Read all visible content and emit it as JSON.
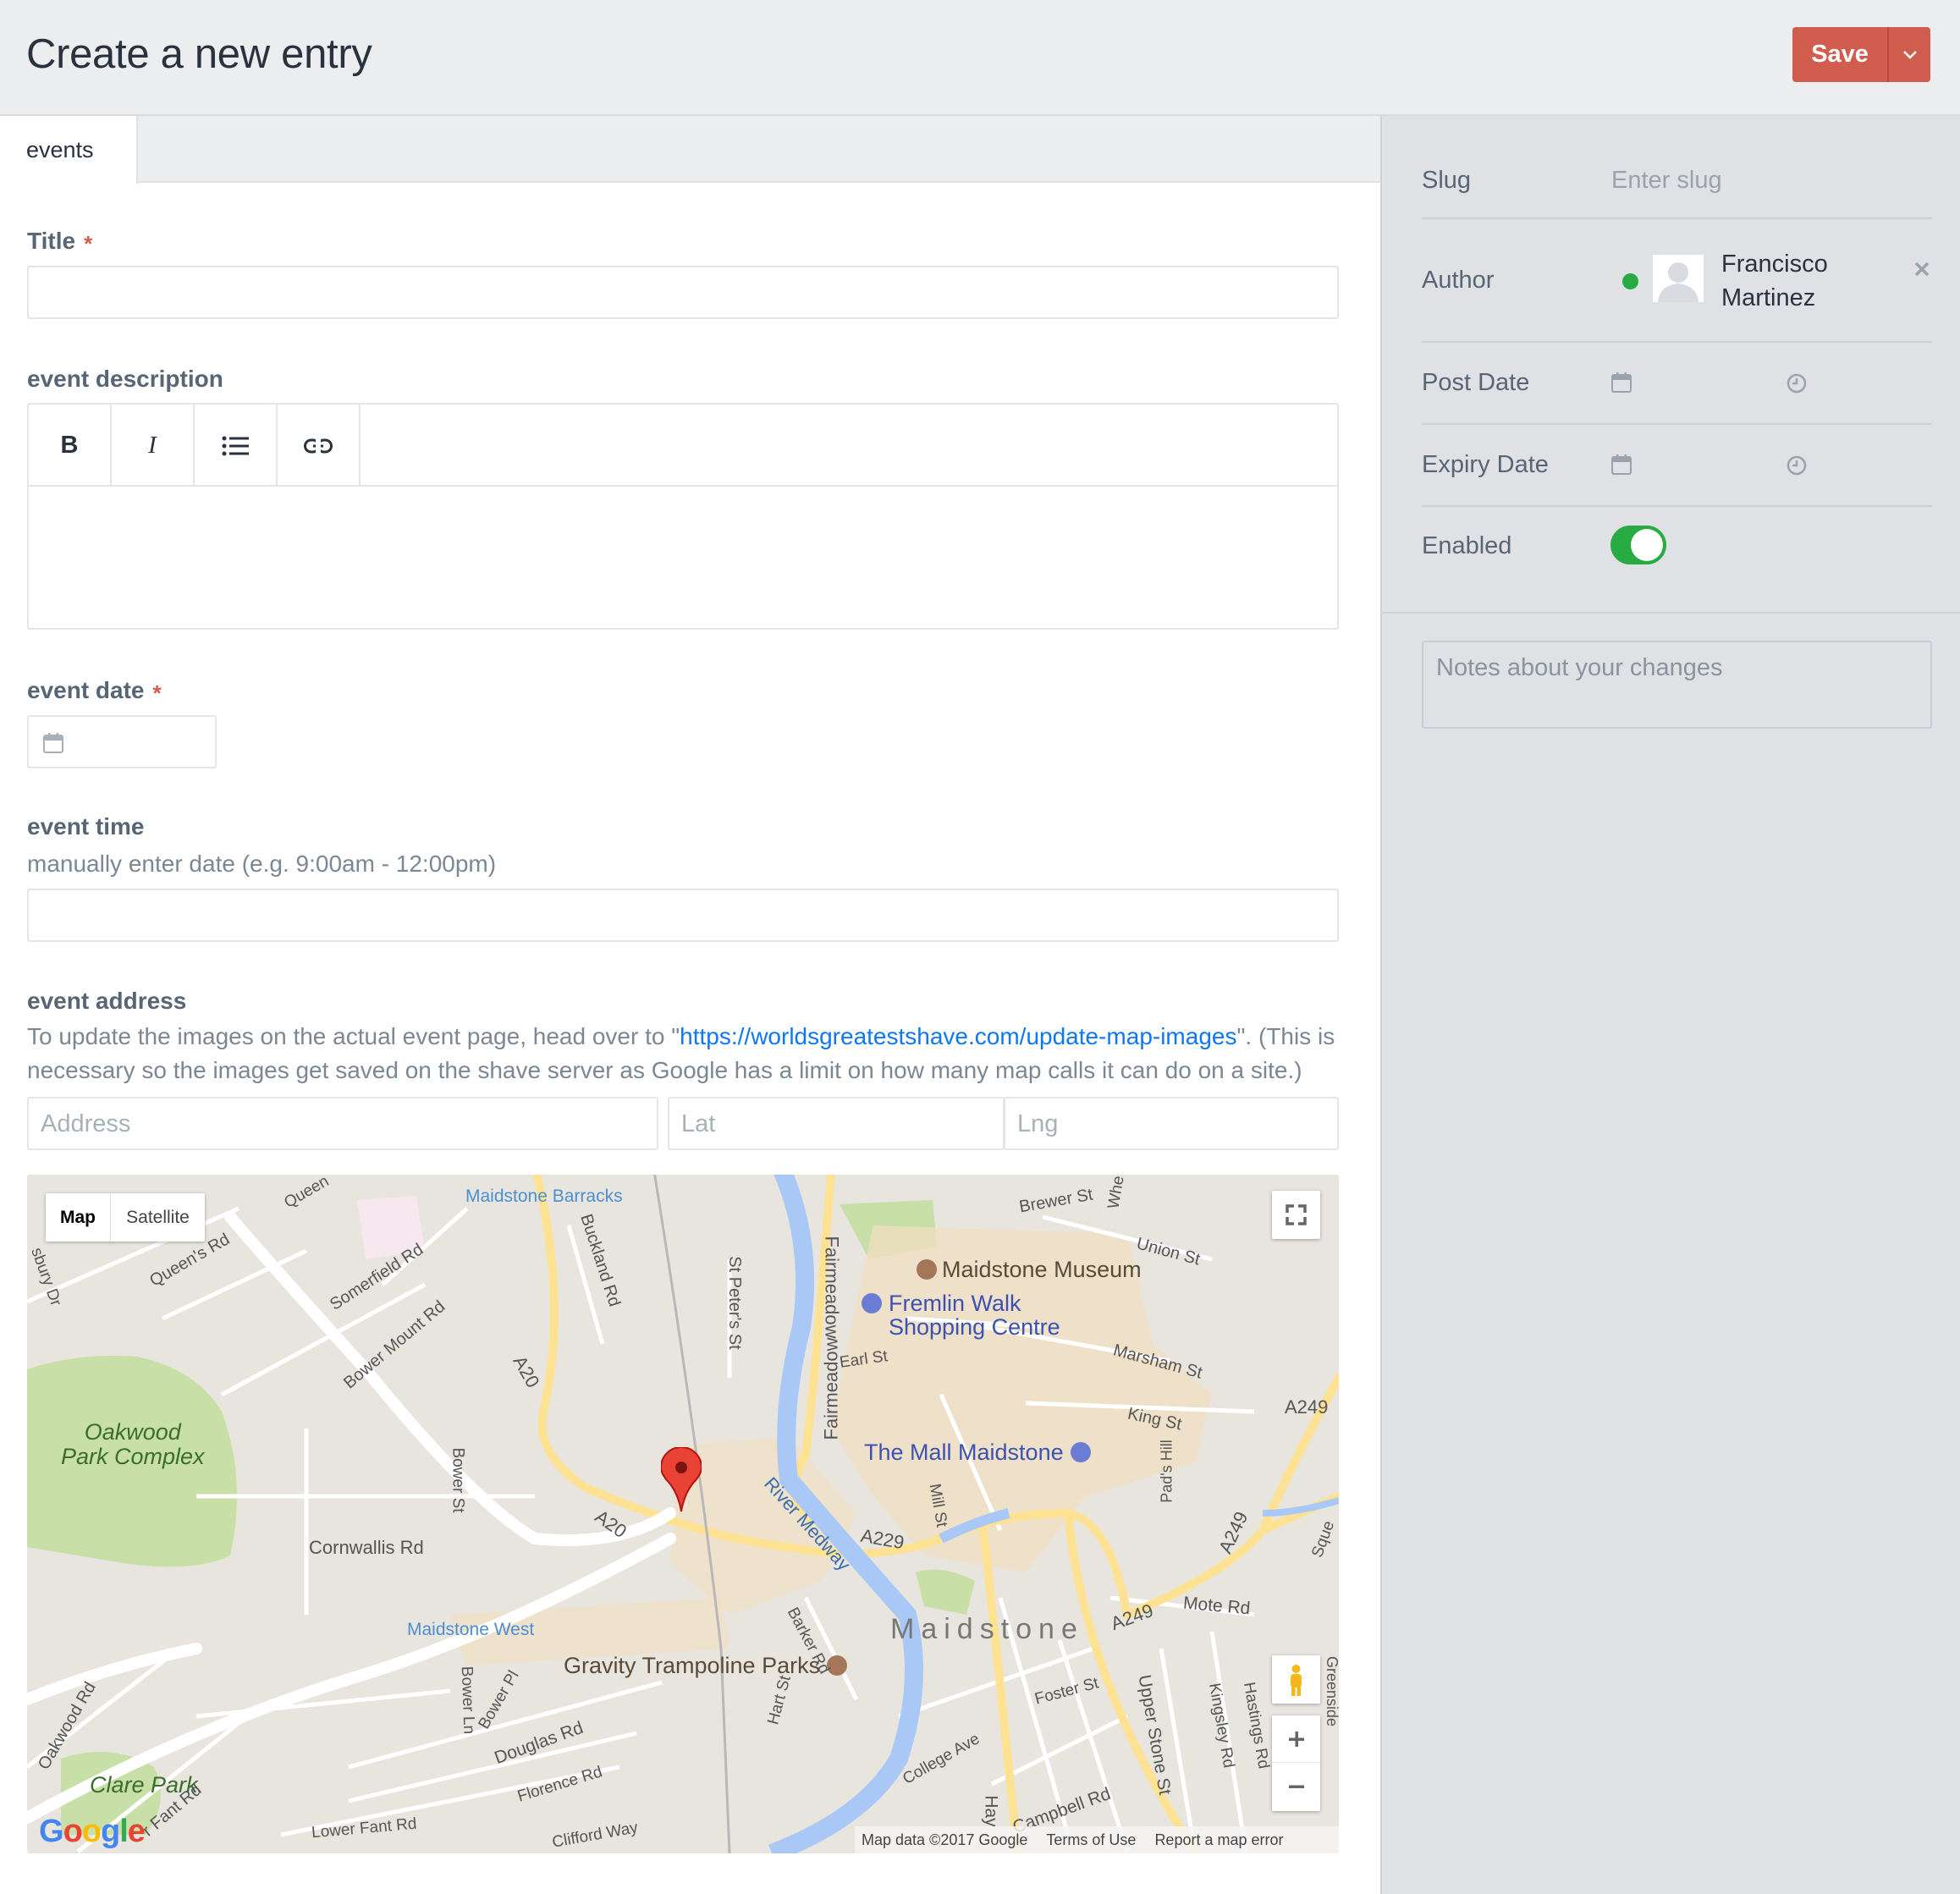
{
  "header": {
    "title": "Create a new entry",
    "save_label": "Save"
  },
  "tabs": [
    {
      "label": "events"
    }
  ],
  "fields": {
    "title": {
      "label": "Title",
      "required_mark": "*",
      "value": ""
    },
    "description": {
      "label": "event description",
      "toolbar": {
        "bold": "B",
        "italic": "I"
      }
    },
    "date": {
      "label": "event date",
      "required_mark": "*"
    },
    "time": {
      "label": "event time",
      "instructions": "manually enter date (e.g. 9:00am - 12:00pm)"
    },
    "address": {
      "label": "event address",
      "instructions_before": "To update the images on the actual event page, head over to \"",
      "instructions_link": "https://worldsgreatestshave.com/update-map-images",
      "instructions_after": "\". (This is necessary so the images get saved on the shave server as Google has a limit on how many map calls it can do on a site.)",
      "address_placeholder": "Address",
      "lat_placeholder": "Lat",
      "lng_placeholder": "Lng"
    }
  },
  "map": {
    "type_map": "Map",
    "type_satellite": "Satellite",
    "attribution": "Map data ©2017 Google",
    "terms": "Terms of Use",
    "report": "Report a map error",
    "logo": "Google",
    "labels": {
      "maidstone_barracks": "Maidstone Barracks",
      "maidstone_museum": "Maidstone Museum",
      "fremlin_1": "Fremlin Walk",
      "fremlin_2": "Shopping Centre",
      "mall": "The Mall Maidstone",
      "oakwood_1": "Oakwood",
      "oakwood_2": "Park Complex",
      "maidstone_west": "Maidstone West",
      "gravity": "Gravity Trampoline Parks",
      "maidstone": "Maidstone",
      "clare_park": "Clare Park",
      "queens_rd": "Queen's Rd",
      "somerfield_rd": "Somerfield Rd",
      "bower_mount_rd": "Bower Mount Rd",
      "buckland_rd": "Buckland Rd",
      "st_peters_st": "St Peter's St",
      "fairmeadow": "Fairmeadow",
      "brewer_st": "Brewer St",
      "union_st": "Union St",
      "marsham_st": "Marsham St",
      "earl_st": "Earl St",
      "king_st": "King St",
      "a249": "A249",
      "a20": "A20",
      "a229": "A229",
      "river_medway": "River Medway",
      "bower_st": "Bower St",
      "cornwallis_rd": "Cornwallis Rd",
      "mill_st": "Mill St",
      "pads_hill": "Pad's Hill",
      "mote_rd": "Mote Rd",
      "barker_rd": "Barker Rd",
      "bower_ln": "Bower Ln",
      "bower_pl": "Bower Pl",
      "douglas_rd": "Douglas Rd",
      "florence_rd": "Florence Rd",
      "foster_st": "Foster St",
      "upper_stone_st": "Upper Stone St",
      "kingsley_rd": "Kingsley Rd",
      "hastings_rd": "Hastings Rd",
      "college_ave": "College Ave",
      "campbell_rd": "Campbell Rd",
      "lower_fant_rd": "Lower Fant Rd",
      "oakwood_rd": "Oakwood Rd",
      "fant_rd": "r Fant Rd",
      "clifford_way": "Clifford Way",
      "sbury_dr": "sbury Dr",
      "queen": "Queen",
      "whe": "Whe",
      "hart_st": "Hart St",
      "hay": "Hay",
      "sque": "Sque",
      "greenside": "Greenside"
    }
  },
  "sidebar": {
    "slug_label": "Slug",
    "slug_placeholder": "Enter slug",
    "author_label": "Author",
    "author_name_1": "Francisco",
    "author_name_2": "Martinez",
    "post_date_label": "Post Date",
    "expiry_date_label": "Expiry Date",
    "enabled_label": "Enabled",
    "enabled": true,
    "notes_placeholder": "Notes about your changes"
  },
  "colors": {
    "accent": "#d15d4e",
    "link": "#0d78f2",
    "toggle_on": "#27ab42",
    "status_online": "#27ab42"
  }
}
